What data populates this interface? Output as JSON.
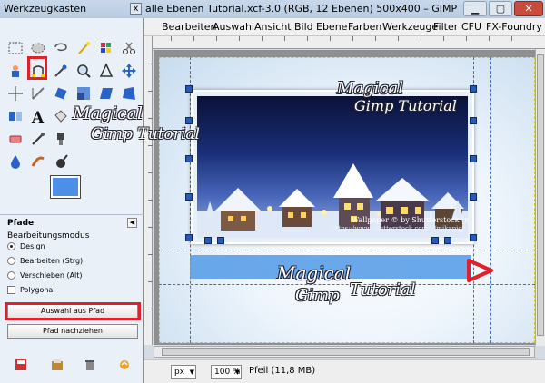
{
  "main_window": {
    "title": "alle Ebenen Tutorial.xcf-3.0 (RGB, 12 Ebenen) 500x400 – GIMP",
    "controls": {
      "minimize": "▁",
      "maximize": "▢",
      "close": "✕"
    }
  },
  "menu": {
    "items": [
      "Bearbeiten",
      "Auswahl",
      "Ansicht",
      "Bild",
      "Ebene",
      "Farben",
      "Werkzeuge",
      "Filter",
      "CFU",
      "FX-Foundry"
    ]
  },
  "canvas": {
    "logo_top_line1": "Magical",
    "logo_top_line2": "Gimp Tutorial",
    "logo_bottom_line1": "Magical",
    "logo_bottom_line2": "Gimp",
    "logo_bottom_line3": "Tutorial",
    "wallpaper_credit": "Wallpaper © by Shutterstock (mika)",
    "wallpaper_url": "https://www.shutterstock.com/g/mikapics"
  },
  "statusbar": {
    "unit": "px",
    "zoom": "100 %",
    "status": "Pfeil (11,8 MB)"
  },
  "toolbox": {
    "title": "Werkzeugkasten",
    "close": "x",
    "logo_line1": "Magical",
    "logo_line2": "Gimp Tutorial",
    "fg_color": "#4d8ee6",
    "bg_color": "#ffffff"
  },
  "tool_options": {
    "title": "Pfade",
    "mode_label": "Bearbeitungsmodus",
    "modes": [
      "Design",
      "Bearbeiten (Strg)",
      "Verschieben (Alt)"
    ],
    "selected_mode": "Design",
    "polygonal_label": "Polygonal",
    "polygonal_checked": false,
    "selection_from_path_button": "Auswahl aus Pfad",
    "stroke_path_button": "Pfad nachziehen"
  },
  "highlight_color": "#e0202a"
}
